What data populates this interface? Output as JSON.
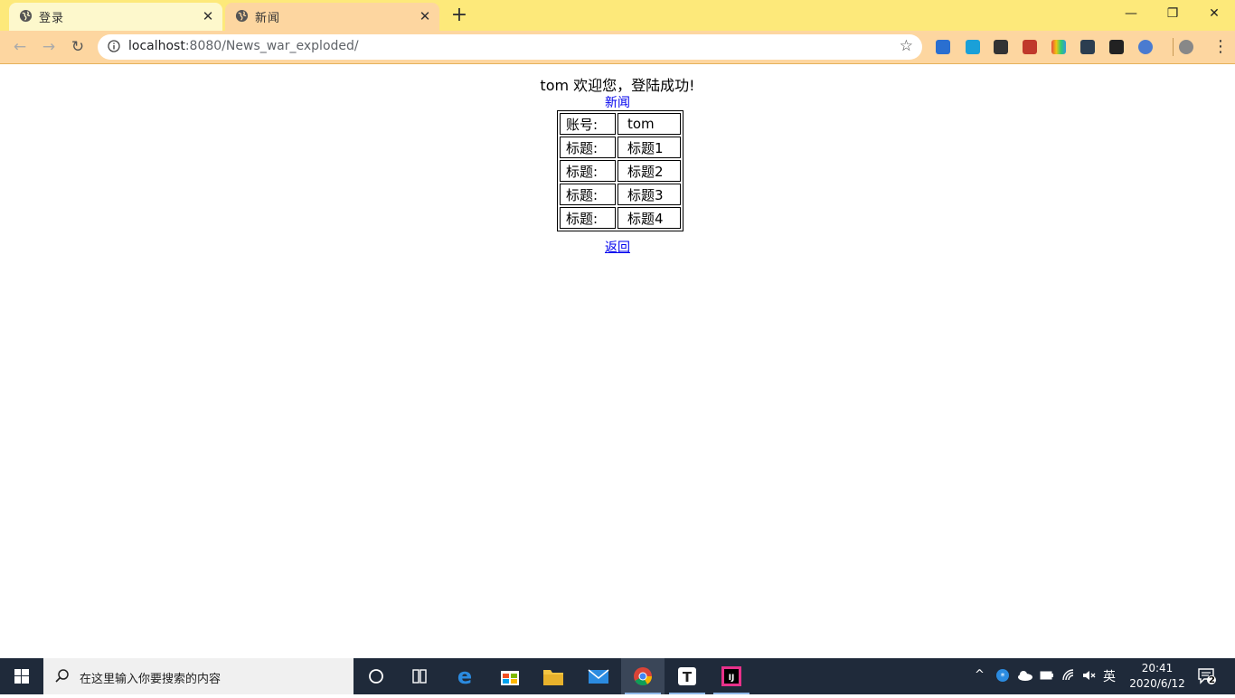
{
  "browser": {
    "tabs": [
      {
        "title": "登录",
        "active": false
      },
      {
        "title": "新闻",
        "active": true
      }
    ],
    "url_host": "localhost",
    "url_rest": ":8080/News_war_exploded/"
  },
  "page": {
    "welcome": "tom 欢迎您，登陆成功!",
    "news_link": "新闻",
    "rows": [
      {
        "label": "账号:",
        "value": "tom"
      },
      {
        "label": "标题:",
        "value": "标题1"
      },
      {
        "label": "标题:",
        "value": "标题2"
      },
      {
        "label": "标题:",
        "value": "标题3"
      },
      {
        "label": "标题:",
        "value": "标题4"
      }
    ],
    "back_link": "返回"
  },
  "taskbar": {
    "search_placeholder": "在这里输入你要搜索的内容",
    "ime": "英",
    "time": "20:41",
    "date": "2020/6/12",
    "notification_count": "2"
  },
  "colors": {
    "tabstrip": "#fde97a",
    "toolbar": "#fdd6a0",
    "link": "#0000ee",
    "taskbar": "#1f2a3a"
  }
}
